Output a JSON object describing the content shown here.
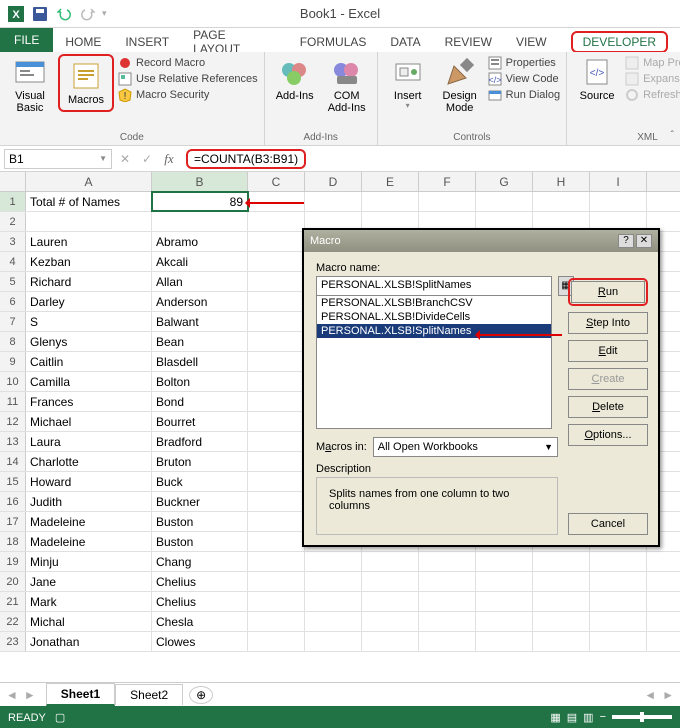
{
  "app": {
    "title": "Book1 - Excel"
  },
  "qat": {
    "items": [
      "excel",
      "save",
      "undo",
      "redo"
    ]
  },
  "tabs": {
    "file": "FILE",
    "list": [
      "HOME",
      "INSERT",
      "PAGE LAYOUT",
      "FORMULAS",
      "DATA",
      "REVIEW",
      "VIEW"
    ],
    "developer": "DEVELOPER"
  },
  "ribbon": {
    "code": {
      "visual_basic": "Visual\nBasic",
      "macros": "Macros",
      "record": "Record Macro",
      "relative": "Use Relative References",
      "security": "Macro Security",
      "label": "Code"
    },
    "addins": {
      "addins": "Add-Ins",
      "com": "COM\nAdd-Ins",
      "label": "Add-Ins"
    },
    "controls": {
      "insert": "Insert",
      "design": "Design\nMode",
      "properties": "Properties",
      "viewcode": "View Code",
      "rundialog": "Run Dialog",
      "label": "Controls"
    },
    "xml": {
      "source": "Source",
      "mapprops": "Map Properties",
      "expansion": "Expansion Pack",
      "refresh": "Refresh Data",
      "label": "XML"
    }
  },
  "formula_bar": {
    "name_box": "B1",
    "formula": "=COUNTA(B3:B91)"
  },
  "grid": {
    "columns": [
      "A",
      "B",
      "C",
      "D",
      "E",
      "F",
      "G",
      "H",
      "I"
    ],
    "rows": [
      {
        "n": 1,
        "a": "Total # of Names",
        "b": "89"
      },
      {
        "n": 2,
        "a": "",
        "b": ""
      },
      {
        "n": 3,
        "a": "Lauren",
        "b": "Abramo"
      },
      {
        "n": 4,
        "a": "Kezban",
        "b": "Akcali"
      },
      {
        "n": 5,
        "a": "Richard",
        "b": "Allan"
      },
      {
        "n": 6,
        "a": "Darley",
        "b": "Anderson"
      },
      {
        "n": 7,
        "a": "S",
        "b": "Balwant"
      },
      {
        "n": 8,
        "a": "Glenys",
        "b": "Bean"
      },
      {
        "n": 9,
        "a": "Caitlin",
        "b": "Blasdell"
      },
      {
        "n": 10,
        "a": "Camilla",
        "b": "Bolton"
      },
      {
        "n": 11,
        "a": "Frances",
        "b": "Bond"
      },
      {
        "n": 12,
        "a": "Michael",
        "b": "Bourret"
      },
      {
        "n": 13,
        "a": "Laura",
        "b": "Bradford"
      },
      {
        "n": 14,
        "a": "Charlotte",
        "b": "Bruton"
      },
      {
        "n": 15,
        "a": "Howard",
        "b": "Buck"
      },
      {
        "n": 16,
        "a": "Judith",
        "b": "Buckner"
      },
      {
        "n": 17,
        "a": "Madeleine",
        "b": "Buston"
      },
      {
        "n": 18,
        "a": "Madeleine",
        "b": "Buston"
      },
      {
        "n": 19,
        "a": "Minju",
        "b": "Chang"
      },
      {
        "n": 20,
        "a": "Jane",
        "b": "Chelius"
      },
      {
        "n": 21,
        "a": "Mark",
        "b": "Chelius"
      },
      {
        "n": 22,
        "a": "Michal",
        "b": "Chesla"
      },
      {
        "n": 23,
        "a": "Jonathan",
        "b": "Clowes"
      }
    ]
  },
  "dialog": {
    "title": "Macro",
    "name_label": "Macro name:",
    "name_value": "PERSONAL.XLSB!SplitNames",
    "items": [
      "PERSONAL.XLSB!BranchCSV",
      "PERSONAL.XLSB!DivideCells",
      "PERSONAL.XLSB!SplitNames"
    ],
    "selected_index": 2,
    "run": "Run",
    "stepinto": "Step Into",
    "edit": "Edit",
    "create": "Create",
    "delete": "Delete",
    "options": "Options...",
    "macros_in_label": "Macros in:",
    "macros_in_value": "All Open Workbooks",
    "desc_label": "Description",
    "desc_text": "Splits names from one column to two columns",
    "cancel": "Cancel"
  },
  "sheets": {
    "active": "Sheet1",
    "other": "Sheet2"
  },
  "status": {
    "ready": "READY"
  }
}
